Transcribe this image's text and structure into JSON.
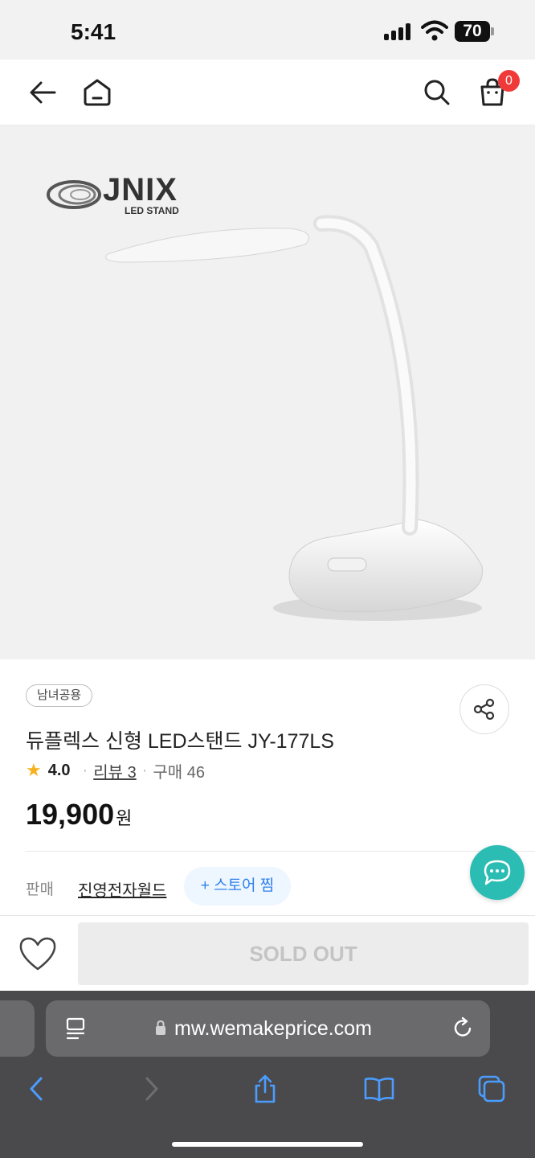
{
  "status_bar": {
    "time": "5:41",
    "battery": "70"
  },
  "header": {
    "back_icon": "arrow-left-icon",
    "home_icon": "home-icon",
    "search_icon": "search-icon",
    "cart_icon": "shopping-bag-icon",
    "cart_count": "0"
  },
  "product": {
    "brand_name": "JNIX",
    "brand_sub": "LED STAND",
    "tag": "남녀공용",
    "title": "듀플렉스 신형 LED스탠드 JY-177LS",
    "rating": "4.0",
    "review_label": "리뷰 3",
    "purchase_label": "구매 46",
    "price": "19,900",
    "price_unit": "원"
  },
  "seller": {
    "label": "판매",
    "name": "진영전자월드",
    "store_fav_label": "+ 스토어 찜"
  },
  "actions": {
    "soldout_label": "SOLD OUT"
  },
  "browser": {
    "url": "mw.wemakeprice.com"
  },
  "colors": {
    "accent": "#2f80ed",
    "chat": "#2bbdb3",
    "badge": "#f03a3a",
    "star": "#f5b21d"
  }
}
